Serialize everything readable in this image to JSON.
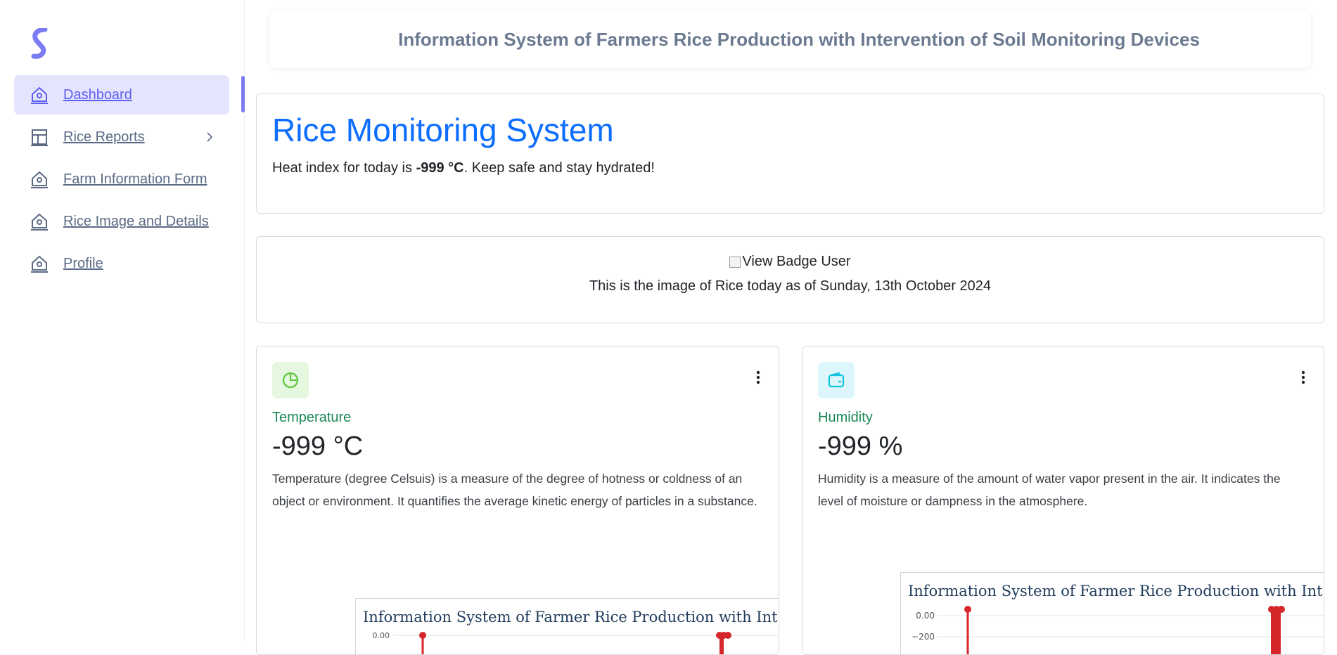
{
  "header": {
    "title": "Information System of Farmers Rice Production with Intervention of Soil Monitoring Devices"
  },
  "sidebar": {
    "items": [
      {
        "label": "Dashboard",
        "icon": "home-icon",
        "active": true
      },
      {
        "label": "Rice Reports",
        "icon": "layout-icon",
        "has_submenu": true
      },
      {
        "label": "Farm Information Form",
        "icon": "home-icon"
      },
      {
        "label": "Rice Image and Details",
        "icon": "home-icon"
      },
      {
        "label": "Profile",
        "icon": "home-icon"
      }
    ]
  },
  "hero": {
    "title": "Rice Monitoring System",
    "heat_prefix": "Heat index for today is ",
    "heat_value": "-999 °C",
    "heat_suffix": ". Keep safe and stay hydrated!"
  },
  "rice_image": {
    "alt": "View Badge User",
    "caption": "This is the image of Rice today as of Sunday, 13th October 2024"
  },
  "temperature": {
    "title": "Temperature",
    "value": "-999 °C",
    "description": "Temperature (degree Celsuis) is a measure of the degree of hotness or coldness of an object or environment. It quantifies the average kinetic energy of particles in a substance.",
    "chart_title": "Information System of Farmer Rice Production with Int",
    "tick_top": "0.00"
  },
  "humidity": {
    "title": "Humidity",
    "value": "-999 %",
    "description": "Humidity is a measure of the amount of water vapor present in the air. It indicates the level of moisture or dampness in the atmosphere.",
    "chart_title": "Information System of Farmer Rice Production with Int",
    "tick_top": "0.00",
    "tick_second": "−200"
  },
  "colors": {
    "accent": "#5d5fef",
    "hero_title": "#0d6efd",
    "metric_title": "#198754",
    "temp_badge_bg": "#e6f7e0",
    "temp_icon": "#5cc73a",
    "hum_badge_bg": "#dcf6fb",
    "hum_icon": "#13c2e0",
    "chart_marker": "#d7262b"
  }
}
